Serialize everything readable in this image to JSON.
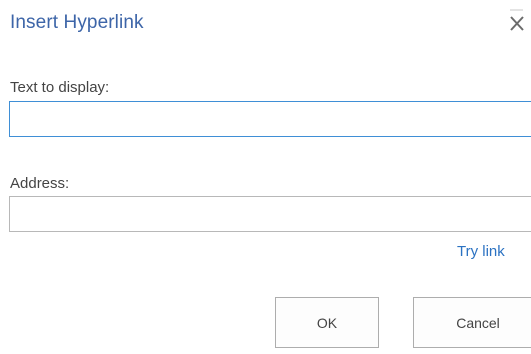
{
  "dialog": {
    "title": "Insert Hyperlink",
    "close_icon": "close-icon"
  },
  "text_to_display": {
    "label": "Text to display:",
    "value": ""
  },
  "address": {
    "label": "Address:",
    "value": ""
  },
  "try_link": {
    "label": "Try link"
  },
  "buttons": {
    "ok_label": "OK",
    "cancel_label": "Cancel"
  },
  "colors": {
    "title": "#3d65a8",
    "link": "#2b72c2",
    "focus_border": "#3f8fd6",
    "field_border": "#b8b8b8",
    "button_border": "#adadad"
  }
}
